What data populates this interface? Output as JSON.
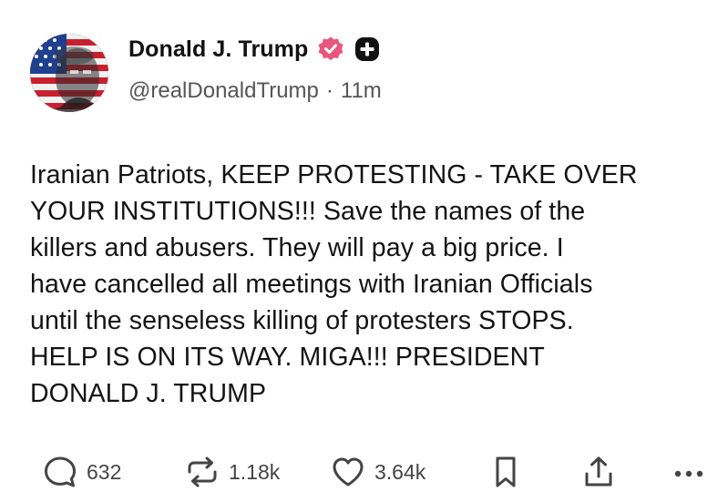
{
  "post": {
    "author": {
      "display_name": "Donald J. Trump",
      "handle": "@realDonaldTrump",
      "separator": "·",
      "time": "11m",
      "verified_badge_icon": "verified-check-icon",
      "extra_badge_icon": "plus-badge-icon",
      "verified_color": "#e8567e"
    },
    "text": "Iranian Patriots, KEEP PROTESTING - TAKE OVER\nYOUR INSTITUTIONS!!! Save the names of the\nkillers and abusers. They will pay a big price. I\nhave cancelled all meetings with Iranian Officials\nuntil the senseless killing of protesters STOPS.\nHELP IS ON ITS WAY. MIGA!!! PRESIDENT\nDONALD J. TRUMP",
    "actions": {
      "reply_count": "632",
      "repost_count": "1.18k",
      "like_count": "3.64k",
      "reply_icon": "reply-bubble-icon",
      "repost_icon": "repost-arrows-icon",
      "like_icon": "heart-icon",
      "save_icon": "bookmark-icon",
      "share_icon": "share-upload-icon",
      "more_icon": "more-dots-icon"
    }
  }
}
